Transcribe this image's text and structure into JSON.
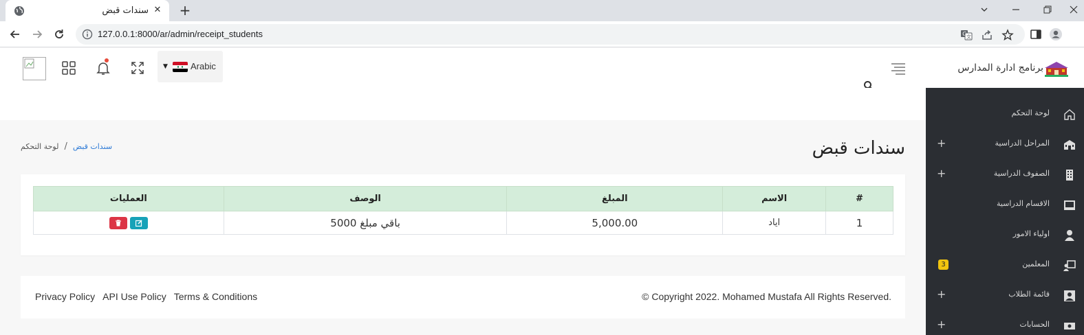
{
  "browser": {
    "tab_title": "سندات قبض",
    "url": "127.0.0.1:8000/ar/admin/receipt_students",
    "new_tab": "+",
    "close": "✕"
  },
  "header": {
    "language": "Arabic",
    "brand": "برنامج ادارة المدارس"
  },
  "sidebar": {
    "items": [
      {
        "label": "لوحة التحكم",
        "icon": "home-icon",
        "expandable": false
      },
      {
        "label": "المراحل الدراسية",
        "icon": "school-icon",
        "expandable": true
      },
      {
        "label": "الصفوف الدراسية",
        "icon": "building-icon",
        "expandable": true
      },
      {
        "label": "الاقسام الدراسية",
        "icon": "monitor-icon",
        "expandable": false
      },
      {
        "label": "اولياء الامور",
        "icon": "user-icon",
        "expandable": false
      },
      {
        "label": "المعلمين",
        "icon": "teacher-icon",
        "expandable": false,
        "badge": "3"
      },
      {
        "label": "قائمة الطلاب",
        "icon": "student-icon",
        "expandable": true
      },
      {
        "label": "الحسابات",
        "icon": "money-icon",
        "expandable": true
      }
    ]
  },
  "page": {
    "title": "سندات قبض",
    "breadcrumb": {
      "home": "لوحة التحكم",
      "sep": "/",
      "current": "سندات قبض"
    }
  },
  "table": {
    "headers": [
      "#",
      "الاسم",
      "المبلغ",
      "الوصف",
      "العمليات"
    ],
    "rows": [
      {
        "num": "1",
        "name": "اياد",
        "amount": "5,000.00",
        "description": "باقي مبلغ 5000"
      }
    ]
  },
  "footer": {
    "links": [
      "Privacy Policy",
      "API Use Policy",
      "Terms & Conditions"
    ],
    "copyright": "© Copyright 2022. Mohamed Mustafa All Rights Reserved."
  },
  "colors": {
    "sidebar_bg": "#2b2e33",
    "table_header_bg": "#d4edda",
    "edit_btn": "#17a2b8",
    "delete_btn": "#dc3545",
    "badge": "#f1c40f",
    "breadcrumb_active": "#2d7ad6"
  }
}
